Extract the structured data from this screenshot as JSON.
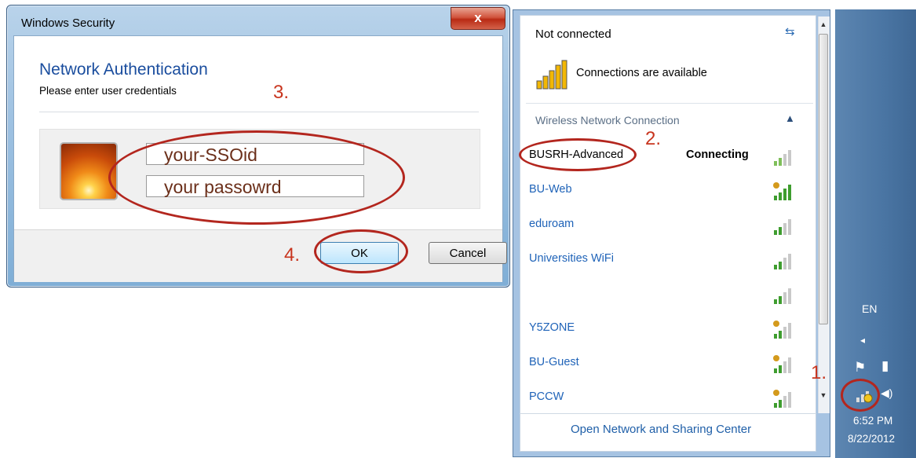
{
  "dialog": {
    "title": "Windows Security",
    "close_label": "x",
    "heading": "Network Authentication",
    "subheading": "Please enter user credentials",
    "username_value": "your-SSOid",
    "password_value": "your passowrd",
    "ok_label": "OK",
    "cancel_label": "Cancel"
  },
  "flyout": {
    "status": "Not connected",
    "availability": "Connections are available",
    "section_title": "Wireless Network Connection",
    "networks": [
      {
        "name": "BUSRH-Advanced",
        "status": "Connecting",
        "secured": false
      },
      {
        "name": "BU-Web",
        "status": "",
        "secured": true
      },
      {
        "name": "eduroam",
        "status": "",
        "secured": false
      },
      {
        "name": "Universities WiFi",
        "status": "",
        "secured": false
      },
      {
        "name": "",
        "status": "",
        "secured": false
      },
      {
        "name": "Y5ZONE",
        "status": "",
        "secured": true
      },
      {
        "name": "BU-Guest",
        "status": "",
        "secured": true
      },
      {
        "name": "PCCW",
        "status": "",
        "secured": true
      }
    ],
    "footer_link": "Open Network and Sharing Center"
  },
  "taskbar": {
    "language": "EN",
    "time": "6:52 PM",
    "date": "8/22/2012"
  },
  "annotations": {
    "step1": "1.",
    "step2": "2.",
    "step3": "3.",
    "step4": "4."
  },
  "colors": {
    "accent_red": "#c8351e",
    "link_blue": "#1f63b8",
    "heading_blue": "#1a4d9e",
    "taskbar": "#4a75a3"
  },
  "icons": [
    "close-icon",
    "user-avatar-icon",
    "refresh-icon",
    "signal-bars-icon",
    "chevron-up-icon",
    "flag-icon",
    "battery-icon",
    "network-tray-icon",
    "speaker-icon"
  ]
}
